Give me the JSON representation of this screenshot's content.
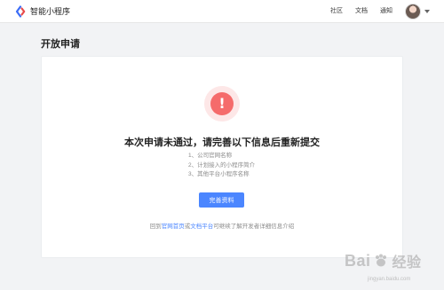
{
  "header": {
    "brand_name": "智能小程序",
    "nav": [
      "社区",
      "文档",
      "通知"
    ],
    "icons": {
      "logo": "swan-logo-icon",
      "avatar": "user-avatar",
      "caret": "chevron-down-icon"
    }
  },
  "page": {
    "title": "开放申请"
  },
  "status": {
    "icon": "exclamation-icon",
    "message": "本次申请未通过，请完善以下信息后重新提交",
    "reasons": [
      "1、公司官网名称",
      "2、计划接入的小程序简介",
      "3、其他平台小程序名称"
    ],
    "button_label": "完善资料",
    "footer": {
      "prefix": "回到",
      "link1": "官网首页",
      "middle": "或",
      "link2": "文档平台",
      "suffix": "可继续了解开发者详细信息介绍"
    }
  },
  "watermark": {
    "text_left": "Bai",
    "text_right": "经验",
    "url": "jingyan.baidu.com",
    "icon": "baidu-paw-icon"
  },
  "colors": {
    "accent": "#4b86ff",
    "alert": "#f56b6b",
    "alert_bg": "#fde7e7",
    "background": "#f2f3f5"
  }
}
